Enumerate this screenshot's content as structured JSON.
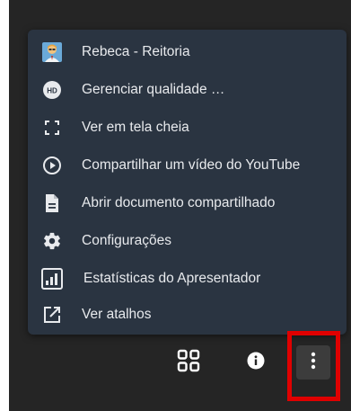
{
  "menu": {
    "items": [
      {
        "label": "Rebeca - Reitoria",
        "icon": "avatar-icon"
      },
      {
        "label": "Gerenciar qualidade …",
        "icon": "hd-icon"
      },
      {
        "label": "Ver em tela cheia",
        "icon": "fullscreen-icon"
      },
      {
        "label": "Compartilhar um vídeo do YouTube",
        "icon": "play-circle-icon"
      },
      {
        "label": "Abrir documento compartilhado",
        "icon": "document-icon"
      },
      {
        "label": "Configurações",
        "icon": "gear-icon"
      },
      {
        "label": "Estatísticas do Apresentador",
        "icon": "bar-chart-icon"
      },
      {
        "label": "Ver atalhos",
        "icon": "external-link-icon"
      }
    ]
  },
  "toolbar": {
    "buttons": [
      "grid-layout-icon",
      "info-icon",
      "more-options-icon"
    ]
  },
  "colors": {
    "menu_bg": "#2a3441",
    "page_bg": "#252525",
    "highlight": "#e00000",
    "icon": "#ffffff"
  }
}
